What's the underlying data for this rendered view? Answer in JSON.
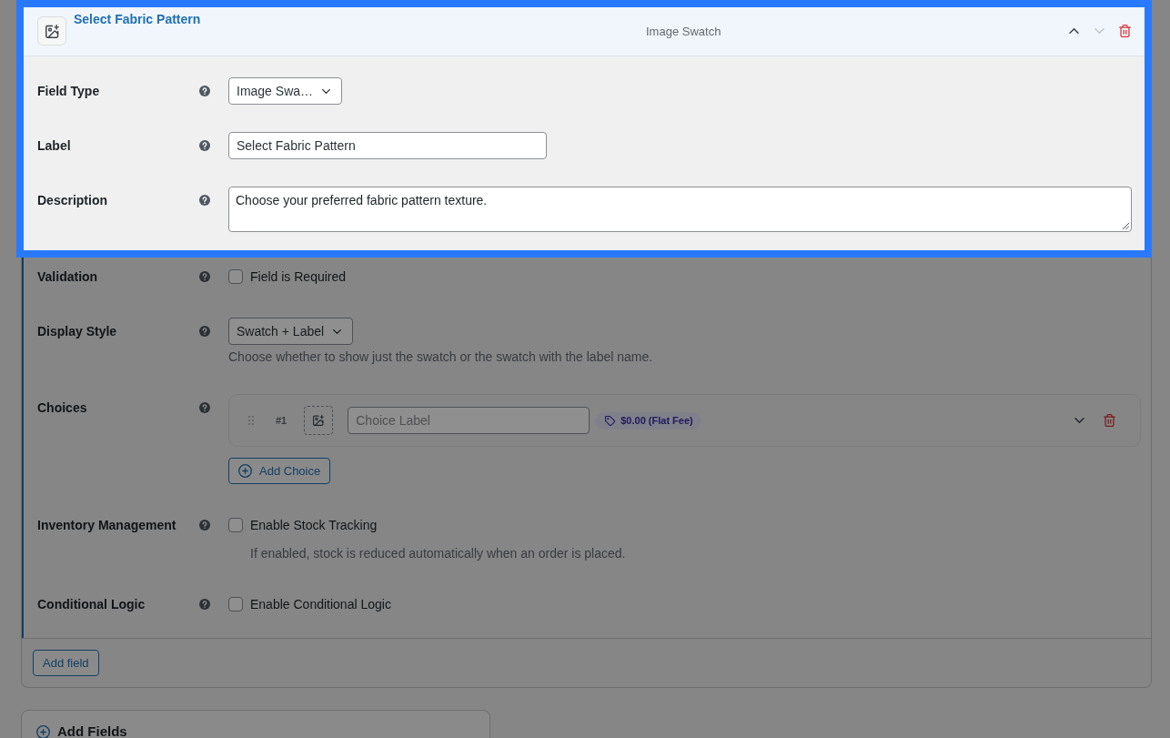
{
  "field": {
    "title": "Select Fabric Pattern",
    "type_label": "Image Swatch",
    "highlighted": true,
    "actions": [
      {
        "kind": "move_up",
        "disabled": false
      },
      {
        "kind": "move_down",
        "disabled": true
      },
      {
        "kind": "delete",
        "disabled": false
      }
    ]
  },
  "rows": [
    {
      "kind": "select",
      "label": "Field Type",
      "highlighted": true,
      "value": "Image Swa…"
    },
    {
      "kind": "text",
      "label": "Label",
      "highlighted": true,
      "value": "Select Fabric Pattern"
    },
    {
      "kind": "textarea",
      "label": "Description",
      "highlighted": true,
      "value": "Choose your preferred fabric pattern texture."
    },
    {
      "kind": "checkbox",
      "label": "Validation",
      "highlighted": false,
      "option": "Field is Required",
      "checked": false
    },
    {
      "kind": "select",
      "label": "Display Style",
      "highlighted": false,
      "value": "Swatch + Label",
      "hint": "Choose whether to show just the swatch or the swatch with the label name."
    },
    {
      "kind": "choices",
      "label": "Choices",
      "highlighted": false,
      "choices": [
        {
          "number": "#1",
          "placeholder": "Choice Label",
          "price": "$0.00 (Flat Fee)"
        }
      ],
      "add_button": "Add Choice"
    },
    {
      "kind": "checkbox",
      "label": "Inventory Management",
      "highlighted": false,
      "option": "Enable Stock Tracking",
      "checked": false,
      "hint": "If enabled, stock is reduced automatically when an order is placed."
    },
    {
      "kind": "checkbox",
      "label": "Conditional Logic",
      "highlighted": false,
      "option": "Enable Conditional Logic",
      "checked": false
    }
  ],
  "footer": {
    "add_button": "Add field"
  },
  "add_fields_panel": {
    "title": "Add Fields"
  }
}
